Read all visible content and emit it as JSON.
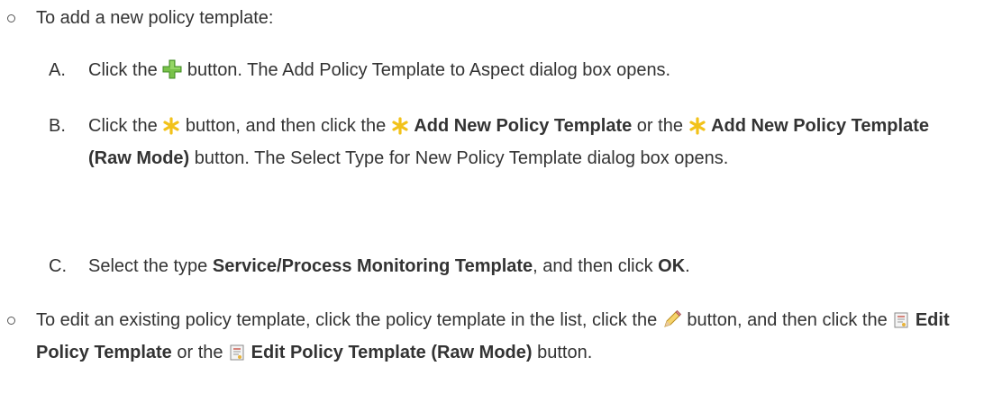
{
  "bullet1": {
    "intro": "To add a new policy template:"
  },
  "stepA": {
    "letter": "A.",
    "text_1": "Click the",
    "text_2": "button. The Add Policy Template to Aspect dialog box opens.",
    "icon": "plus-icon"
  },
  "stepB": {
    "letter": "B.",
    "text_1": "Click the",
    "text_2": "button, and then click the",
    "bold_1": "Add New Policy Template",
    "text_3": "or the",
    "bold_2": "Add New Policy Template (Raw Mode)",
    "text_4": "button. The Select Type for New Policy Template dialog box opens.",
    "icon": "asterisk-icon"
  },
  "stepC": {
    "letter": "C.",
    "text_1": "Select the type",
    "bold_1": "Service/Process Monitoring Template",
    "text_2": ", and then click",
    "bold_2": "OK",
    "text_3": "."
  },
  "bullet2": {
    "text_1": "To edit an existing policy template, click the policy template in the list, click the",
    "text_2": "button, and then click the",
    "bold_1": "Edit Policy Template",
    "text_3": "or the",
    "bold_2": "Edit Policy Template (Raw Mode)",
    "text_4": "button.",
    "icon_edit": "pencil-icon",
    "icon_template": "policy-template-icon"
  }
}
